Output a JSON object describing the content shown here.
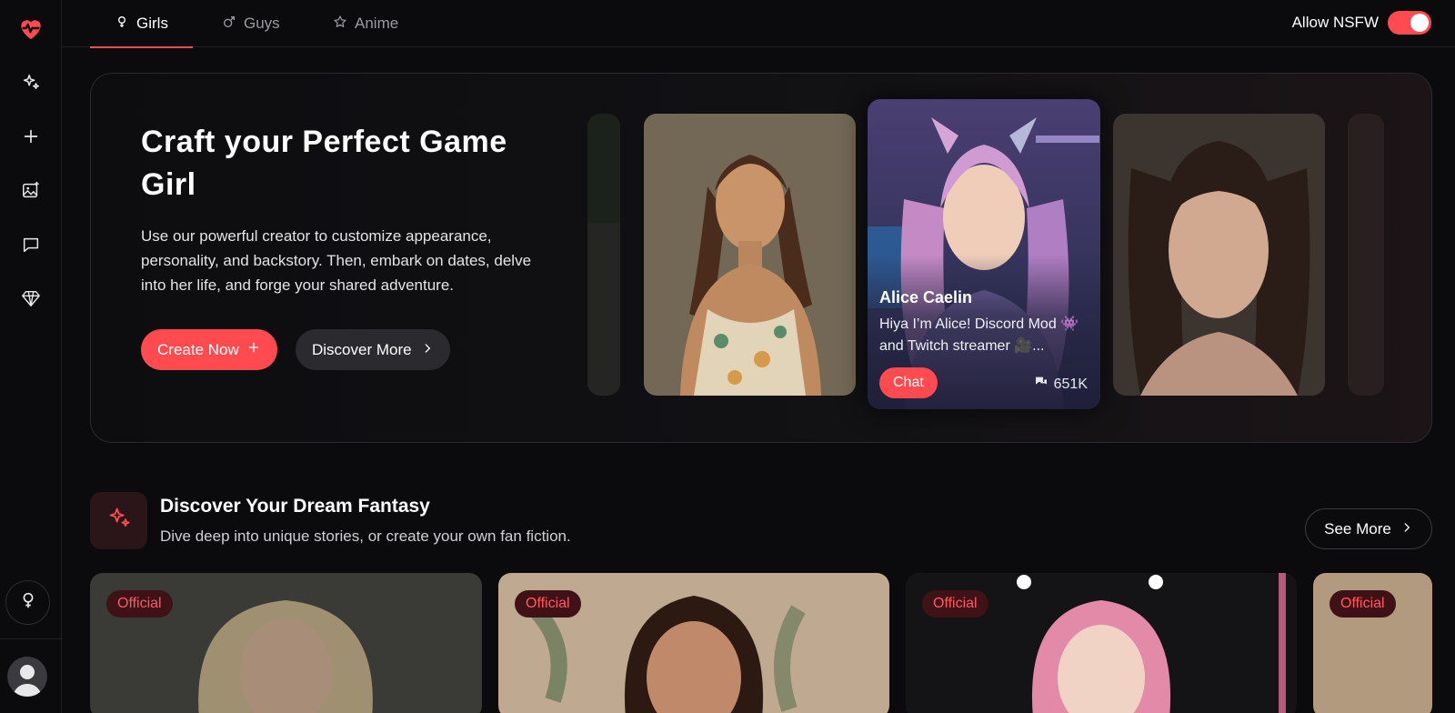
{
  "sidebar": {
    "items": [
      {
        "icon": "heartbeat-logo-icon"
      },
      {
        "icon": "sparkles-icon"
      },
      {
        "icon": "plus-icon"
      },
      {
        "icon": "image-plus-icon"
      },
      {
        "icon": "chat-icon"
      },
      {
        "icon": "diamond-icon"
      }
    ],
    "gender_icon": "female-icon",
    "avatar_icon": "user-avatar-icon"
  },
  "tabs": [
    {
      "label": "Girls",
      "icon": "female-icon",
      "active": true
    },
    {
      "label": "Guys",
      "icon": "male-icon",
      "active": false
    },
    {
      "label": "Anime",
      "icon": "star-icon",
      "active": false
    }
  ],
  "nsfw": {
    "label": "Allow NSFW",
    "enabled": true
  },
  "hero": {
    "title": "Craft your Perfect Game Girl",
    "description": "Use our powerful creator to customize appearance, personality, and backstory. Then, embark on dates, delve into her life, and forge your shared adventure.",
    "create_label": "Create Now",
    "discover_label": "Discover More",
    "featured": {
      "name": "Alice Caelin",
      "description": "Hiya I’m Alice! Discord Mod 👾 and Twitch streamer 🎥...",
      "chat_label": "Chat",
      "count": "651K"
    }
  },
  "section": {
    "title": "Discover Your Dream Fantasy",
    "subtitle": "Dive deep into unique stories, or create your own fan fiction.",
    "see_more_label": "See More",
    "stories": [
      {
        "badge": "Official"
      },
      {
        "badge": "Official"
      },
      {
        "badge": "Official"
      },
      {
        "badge": "Official"
      }
    ]
  },
  "colors": {
    "accent": "#ff4a4f",
    "background": "#0b0b0d",
    "surface": "#2a2a2f"
  }
}
